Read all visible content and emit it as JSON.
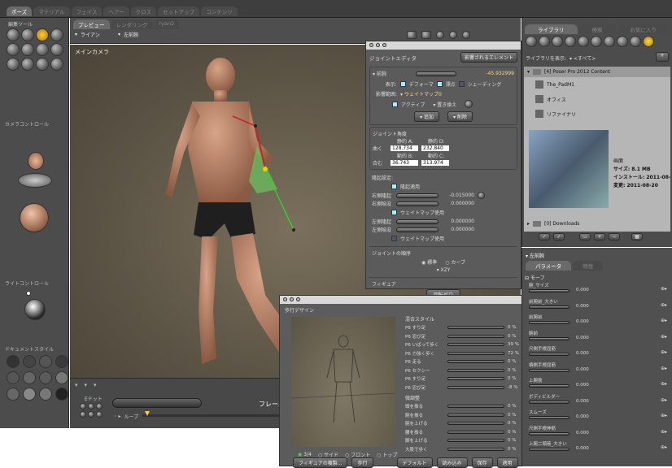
{
  "top_tabs": [
    "ポーズ",
    "マテリアル",
    "フェイス",
    "ヘアー",
    "クロス",
    "セットアップ",
    "コンテンツ"
  ],
  "left": {
    "edit_tools_title": "編集ツール",
    "camera_control_title": "カメラコントロール",
    "light_control_title": "ライトコントロール",
    "document_style_title": "ドキュメントスタイル"
  },
  "viewport": {
    "tabs": [
      "プレビュー",
      "レンダリング",
      "ryan2"
    ],
    "figure_menu": "ライアン",
    "part_menu": "左前腕",
    "camera_label": "メインカメラ"
  },
  "joint_editor": {
    "title": "ジョイントエディタ",
    "zero_button": "影響されるエレメント",
    "twist_label": "前腕",
    "twist_value": "-45.932999",
    "display_label": "表示:",
    "display_opts": [
      "デフォーマ",
      "漂点",
      "シェーディング"
    ],
    "influence_label": "影響範囲:",
    "influence_value": "ウェイトマップ0",
    "active_label": "アクティブ",
    "replace_label": "置き換え",
    "add_button": "追加",
    "delete_button": "削除",
    "joint_angle_title": "ジョイント角度",
    "static_a": "静的 A:",
    "static_b": "静的 D:",
    "outer_label": "曲く",
    "outer_a": "128.734",
    "outer_b": "232.840",
    "dyn_a": "動的 B:",
    "dyn_b": "動的 C:",
    "inner_label": "合む",
    "inner_a": "36.743",
    "inner_b": "313.974",
    "bulge_title": "隆起設定:",
    "bulge_apply": "隆起適用",
    "right_bulge": "右側隆起",
    "right_bulge_val": "-0.015000",
    "right_dent": "右側陥没",
    "right_dent_val": "0.000000",
    "wm_use": "ウェイトマップ使用",
    "left_bulge": "左側隆起",
    "left_bulge_val": "0.000000",
    "left_dent": "左側陥没",
    "left_dent_val": "0.000000",
    "order_title": "ジョイントの順序",
    "order_opts": [
      "標準",
      "カーブ"
    ],
    "order_value": "XZY",
    "figure_title": "フィギュア",
    "zero_figure": "回転ゼロ"
  },
  "walk": {
    "title": "歩行デザイン",
    "mix_title": "混合スタイル",
    "mix": [
      {
        "name": "P6 すり足",
        "val": "0 %"
      },
      {
        "name": "P6 忍び足",
        "val": "0 %"
      },
      {
        "name": "P6 いばって歩く",
        "val": "39 %"
      },
      {
        "name": "P6 力強く歩く",
        "val": "72 %"
      },
      {
        "name": "P6 走る",
        "val": "0 %"
      },
      {
        "name": "P6 セクシー",
        "val": "0 %"
      },
      {
        "name": "P6 すり足",
        "val": "0 %"
      },
      {
        "name": "P6 忍び足",
        "val": "-8 %"
      }
    ],
    "tweak_title": "微調整",
    "tweak": [
      {
        "name": "頭を振る",
        "val": "0 %"
      },
      {
        "name": "腕を振る",
        "val": "0 %"
      },
      {
        "name": "腕を上げる",
        "val": "0 %"
      },
      {
        "name": "腰を振る",
        "val": "0 %"
      },
      {
        "name": "脚を上げる",
        "val": "0 %"
      },
      {
        "name": "大股で歩く",
        "val": "0 %"
      }
    ],
    "views": [
      "3/4",
      "サイド",
      "フロント",
      "トップ"
    ],
    "buttons": [
      "フィギュアの複製...",
      "歩行",
      "デフォルト",
      "読み込み",
      "保存",
      "適用"
    ]
  },
  "timeline": {
    "frame_label": "フレーム",
    "loop_label": "ループ",
    "edit_label": "Eドット"
  },
  "library": {
    "tabs": [
      "ライブラリ",
      "検索",
      "お気に入り"
    ],
    "show_label": "ライブラリを表示:",
    "show_value": "<すべて>",
    "root": "[4]  Poser Pro 2012 Content",
    "items": [
      "The_PadM1",
      "オフィス",
      "リファイナリ"
    ],
    "preview_title": "画面",
    "size": "サイズ: 8.1 MB",
    "install": "インストール: 2011-08-",
    "modified": "変更: 2011-08-20",
    "downloads": "[0]  Downloads"
  },
  "params": {
    "title": "左前腕",
    "tabs": [
      "パラメータ",
      "特性"
    ],
    "section": "モーフ",
    "rows": [
      {
        "name": "腕_サイズ",
        "val": "0.000"
      },
      {
        "name": "前腕前_大きい",
        "val": "0.000"
      },
      {
        "name": "前腕前",
        "val": "0.000"
      },
      {
        "name": "腕前",
        "val": "0.000"
      },
      {
        "name": "尺側手根屈筋",
        "val": "0.000"
      },
      {
        "name": "橈側手根屈筋",
        "val": "0.000"
      },
      {
        "name": "上腕筋",
        "val": "0.000"
      },
      {
        "name": "ボディビルダー",
        "val": "0.000"
      },
      {
        "name": "スムーズ",
        "val": "0.000"
      },
      {
        "name": "尺側手根伸筋",
        "val": "0.000"
      },
      {
        "name": "上腕二頭筋_大きい",
        "val": "0.000"
      }
    ]
  }
}
